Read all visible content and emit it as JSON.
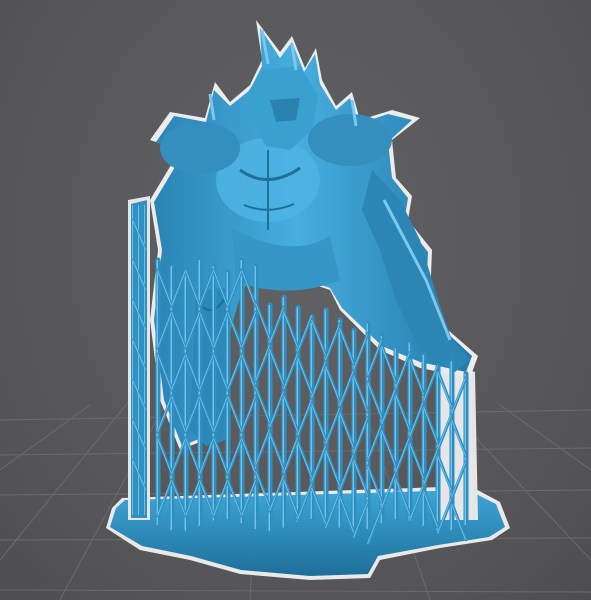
{
  "scene": {
    "subject": "slicer-viewport",
    "model_color": "#3aa0cf",
    "model_shadow": "#1f6f98",
    "model_highlight": "#7cc8ec",
    "outline_color": "#e8e8e8",
    "background_color": "#5a5a5c",
    "grid_color": "#6a6a6c",
    "icons": [
      "miniature-model",
      "support-lattice",
      "build-raft"
    ]
  }
}
